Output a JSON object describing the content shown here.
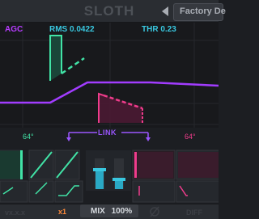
{
  "header": {
    "title": "SLOTH",
    "preset_name": "Factory De"
  },
  "graph": {
    "agc_label": "AGC",
    "rms_readout": "RMS 0.0422",
    "thr_readout": "THR 0.23"
  },
  "link_section": {
    "left_angle": "64°",
    "right_angle": "64°",
    "link_label": "LINK"
  },
  "footer": {
    "version": "vx.x.x",
    "oversample": "x1",
    "mix_label": "MIX",
    "mix_value": "100%",
    "diff_label": "DIFF"
  },
  "colors": {
    "accent_purple": "#9b56ff",
    "agc_purple": "#b73cff",
    "green": "#41e3a6",
    "pink": "#f03c8c",
    "cyan": "#39c7df",
    "orange": "#ff8a3a"
  }
}
